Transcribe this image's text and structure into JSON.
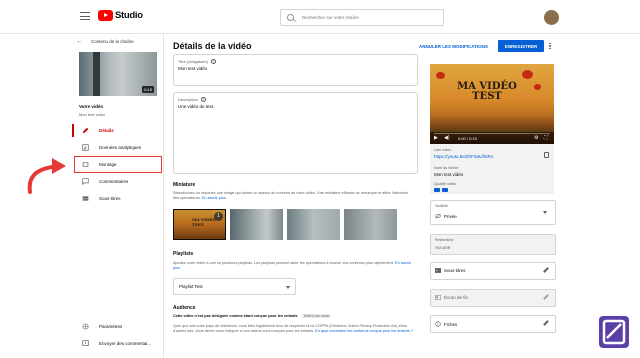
{
  "header": {
    "logo_text": "Studio",
    "search_placeholder": "Rechercher sur votre chaîne"
  },
  "sidebar": {
    "back_label": "Contenu de la chaîne",
    "thumbnail_duration": "0:15",
    "video_heading": "Votre vidéo",
    "video_name": "Mon test vidéo",
    "items": [
      {
        "label": "Détails",
        "icon": "pencil-icon"
      },
      {
        "label": "Données analytiques",
        "icon": "analytics-icon"
      },
      {
        "label": "Montage",
        "icon": "film-icon"
      },
      {
        "label": "Commentaires",
        "icon": "comment-icon"
      },
      {
        "label": "Sous-titres",
        "icon": "subtitles-icon"
      }
    ],
    "bottom_items": [
      {
        "label": "Paramètres",
        "icon": "gear-icon"
      },
      {
        "label": "Envoyer des commentai...",
        "icon": "feedback-icon"
      }
    ]
  },
  "main": {
    "title": "Détails de la vidéo",
    "cancel_label": "ANNULER LES MODIFICATIONS",
    "save_label": "ENREGISTRER",
    "title_field": {
      "label": "Titre (obligatoire)",
      "value": "Mon test vidéo"
    },
    "description_field": {
      "label": "Description",
      "value": "Une vidéo de test."
    },
    "thumbnail": {
      "heading": "Miniature",
      "desc": "Sélectionnez ou importez une image qui donne un aperçu du contenu de votre vidéo. Une miniature efficace se remarque et attire l'attention des spectateurs.",
      "link": "En savoir plus",
      "badge": "1",
      "text": "MA VIDÉO TEST"
    },
    "playlists": {
      "heading": "Playlists",
      "desc": "Ajoutez votre vidéo à une ou plusieurs playlists. Les playlists peuvent aider les spectateurs à trouver vos contenus plus rapidement.",
      "link": "En savoir plus",
      "value": "Playlist Test"
    },
    "audience": {
      "heading": "Audience",
      "status": "Cette vidéo n'est pas désignée comme étant conçue pour les enfants",
      "status_tag": "Défini par vous",
      "desc": "Quel que soit votre pays de résidence, vous êtes légalement tenu de respecter la loi COPPA (Childrens Online Privacy Protection Act) et/ou d'autres lois. Vous devez nous indiquer si vos vidéos sont conçues pour les enfants.",
      "link": "En quoi consistent les contenus conçus pour les enfants ?"
    }
  },
  "right_panel": {
    "preview_text": "MA VIDÉO TEST",
    "time": "0:00 / 0:15",
    "link_label": "Lien vidéo",
    "link_value": "https://youtu.be/2hFSaUfInRo",
    "filename_label": "Nom du fichier",
    "filename_value": "Mon test vidéo",
    "quality_label": "Qualité vidéo",
    "visibility_label": "Visibilité",
    "visibility_value": "Privée",
    "restrictions_label": "Restrictions",
    "restrictions_value": "Aucune",
    "subtitles_label": "Sous-titres",
    "end_screen_label": "Écran de fin",
    "cards_label": "Fiches"
  },
  "colors": {
    "accent": "#065fd4",
    "brand": "#ff0000",
    "annotation": "#e53935"
  }
}
